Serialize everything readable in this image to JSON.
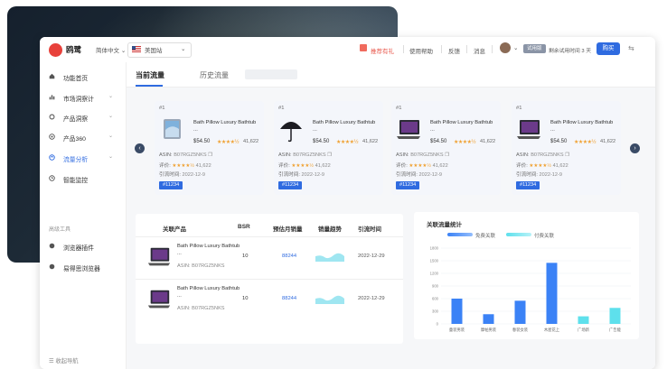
{
  "app": {
    "name": "鸥鹭"
  },
  "topbar": {
    "language": "简体中文",
    "site": "美国站",
    "gift_link": "推荐有礼",
    "help_link": "使用帮助",
    "feedback_link": "反馈",
    "messages_link": "消息",
    "trial_badge": "试用版",
    "trial_text": "剩余试用时间 3 天",
    "buy_button": "购买"
  },
  "sidebar": {
    "items": [
      {
        "label": "功能首页",
        "icon": "home-icon",
        "has_chevron": false
      },
      {
        "label": "市场洞察计",
        "icon": "chart-icon",
        "has_chevron": true
      },
      {
        "label": "产品洞察",
        "icon": "search-icon",
        "has_chevron": true
      },
      {
        "label": "产品360",
        "icon": "target-icon",
        "has_chevron": true
      },
      {
        "label": "流量分析",
        "icon": "traffic-icon",
        "has_chevron": true
      },
      {
        "label": "智能监控",
        "icon": "monitor-icon",
        "has_chevron": false
      }
    ],
    "section_label": "高级工具",
    "tools": [
      {
        "label": "浏览器插件",
        "icon": "plugin-icon"
      },
      {
        "label": "易得思浏览器",
        "icon": "browser-icon"
      }
    ],
    "collapse_label": "收起导航"
  },
  "tabs": [
    {
      "label": "当前流量"
    },
    {
      "label": "历史流量"
    }
  ],
  "product_cards": [
    {
      "rank": "#1",
      "name": "Bath Pillow Luxury Bathtub ...",
      "price": "$54.50",
      "stars": "★★★★½",
      "reviews": "41,622",
      "asin": "B07RGZ5NKS",
      "rating": "★★★★½",
      "rating_count": "41,622",
      "date": "2022-12-9",
      "tag": "#11234",
      "asin_label": "ASIN:",
      "rating_label": "评价:",
      "date_label": "引流时间:",
      "thumb": "tablet-product"
    },
    {
      "rank": "#1",
      "name": "Bath Pillow Luxury Bathtub ...",
      "price": "$54.50",
      "stars": "★★★★½",
      "reviews": "41,622",
      "asin": "B07RGZ5NKS",
      "rating": "★★★★½",
      "rating_count": "41,622",
      "date": "2022-12-9",
      "tag": "#11234",
      "asin_label": "ASIN:",
      "rating_label": "评价:",
      "date_label": "引流时间:",
      "thumb": "umbrella-product"
    },
    {
      "rank": "#1",
      "name": "Bath Pillow Luxury Bathtub ...",
      "price": "$54.50",
      "stars": "★★★★½",
      "reviews": "41,622",
      "asin": "B07RGZ5NKS",
      "rating": "★★★★½",
      "rating_count": "41,622",
      "date": "2022-12-9",
      "tag": "#11234",
      "asin_label": "ASIN:",
      "rating_label": "评价:",
      "date_label": "引流时间:",
      "thumb": "laptop-product"
    },
    {
      "rank": "#1",
      "name": "Bath Pillow Luxury Bathtub ...",
      "price": "$54.50",
      "stars": "★★★★½",
      "reviews": "41,622",
      "asin": "B07RGZ5NKS",
      "rating": "★★★★½",
      "rating_count": "41,622",
      "date": "2022-12-9",
      "tag": "#11234",
      "asin_label": "ASIN:",
      "rating_label": "评价:",
      "date_label": "引流时间:",
      "thumb": "laptop-product"
    }
  ],
  "related_table": {
    "headers": [
      "关联产品",
      "BSR",
      "预估月销量",
      "销量趋势",
      "引流时间"
    ],
    "rows": [
      {
        "name": "Bath Pillow Luxury Bathtub ...",
        "asin": "ASIN: B07RGZ5NKS",
        "bsr": "10",
        "sales": "88244",
        "date": "2022-12-29"
      },
      {
        "name": "Bath Pillow Luxury Bathtub ...",
        "asin": "ASIN: B07RGZ5NKS",
        "bsr": "10",
        "sales": "88244",
        "date": "2022-12-29"
      }
    ]
  },
  "traffic_chart": {
    "title": "关联流量统计",
    "legend_free": "免费关联",
    "legend_paid": "付费关联",
    "free_color": "#3b82f6",
    "paid_color": "#5ee0ec"
  },
  "chart_data": {
    "type": "bar",
    "title": "关联流量统计",
    "categories": [
      "童装男装",
      "摩帕男装",
      "春装女装",
      "木屋花上",
      "广场新",
      "广告能"
    ],
    "series": [
      {
        "name": "免费关联",
        "values": [
          600,
          230,
          550,
          1450,
          null,
          null
        ]
      },
      {
        "name": "付费关联",
        "values": [
          null,
          null,
          null,
          null,
          180,
          380
        ]
      }
    ],
    "yticks": [
      0,
      300,
      600,
      900,
      1200,
      1500,
      1800
    ],
    "ylim": [
      0,
      1800
    ],
    "grid": true,
    "legend_position": "top"
  }
}
